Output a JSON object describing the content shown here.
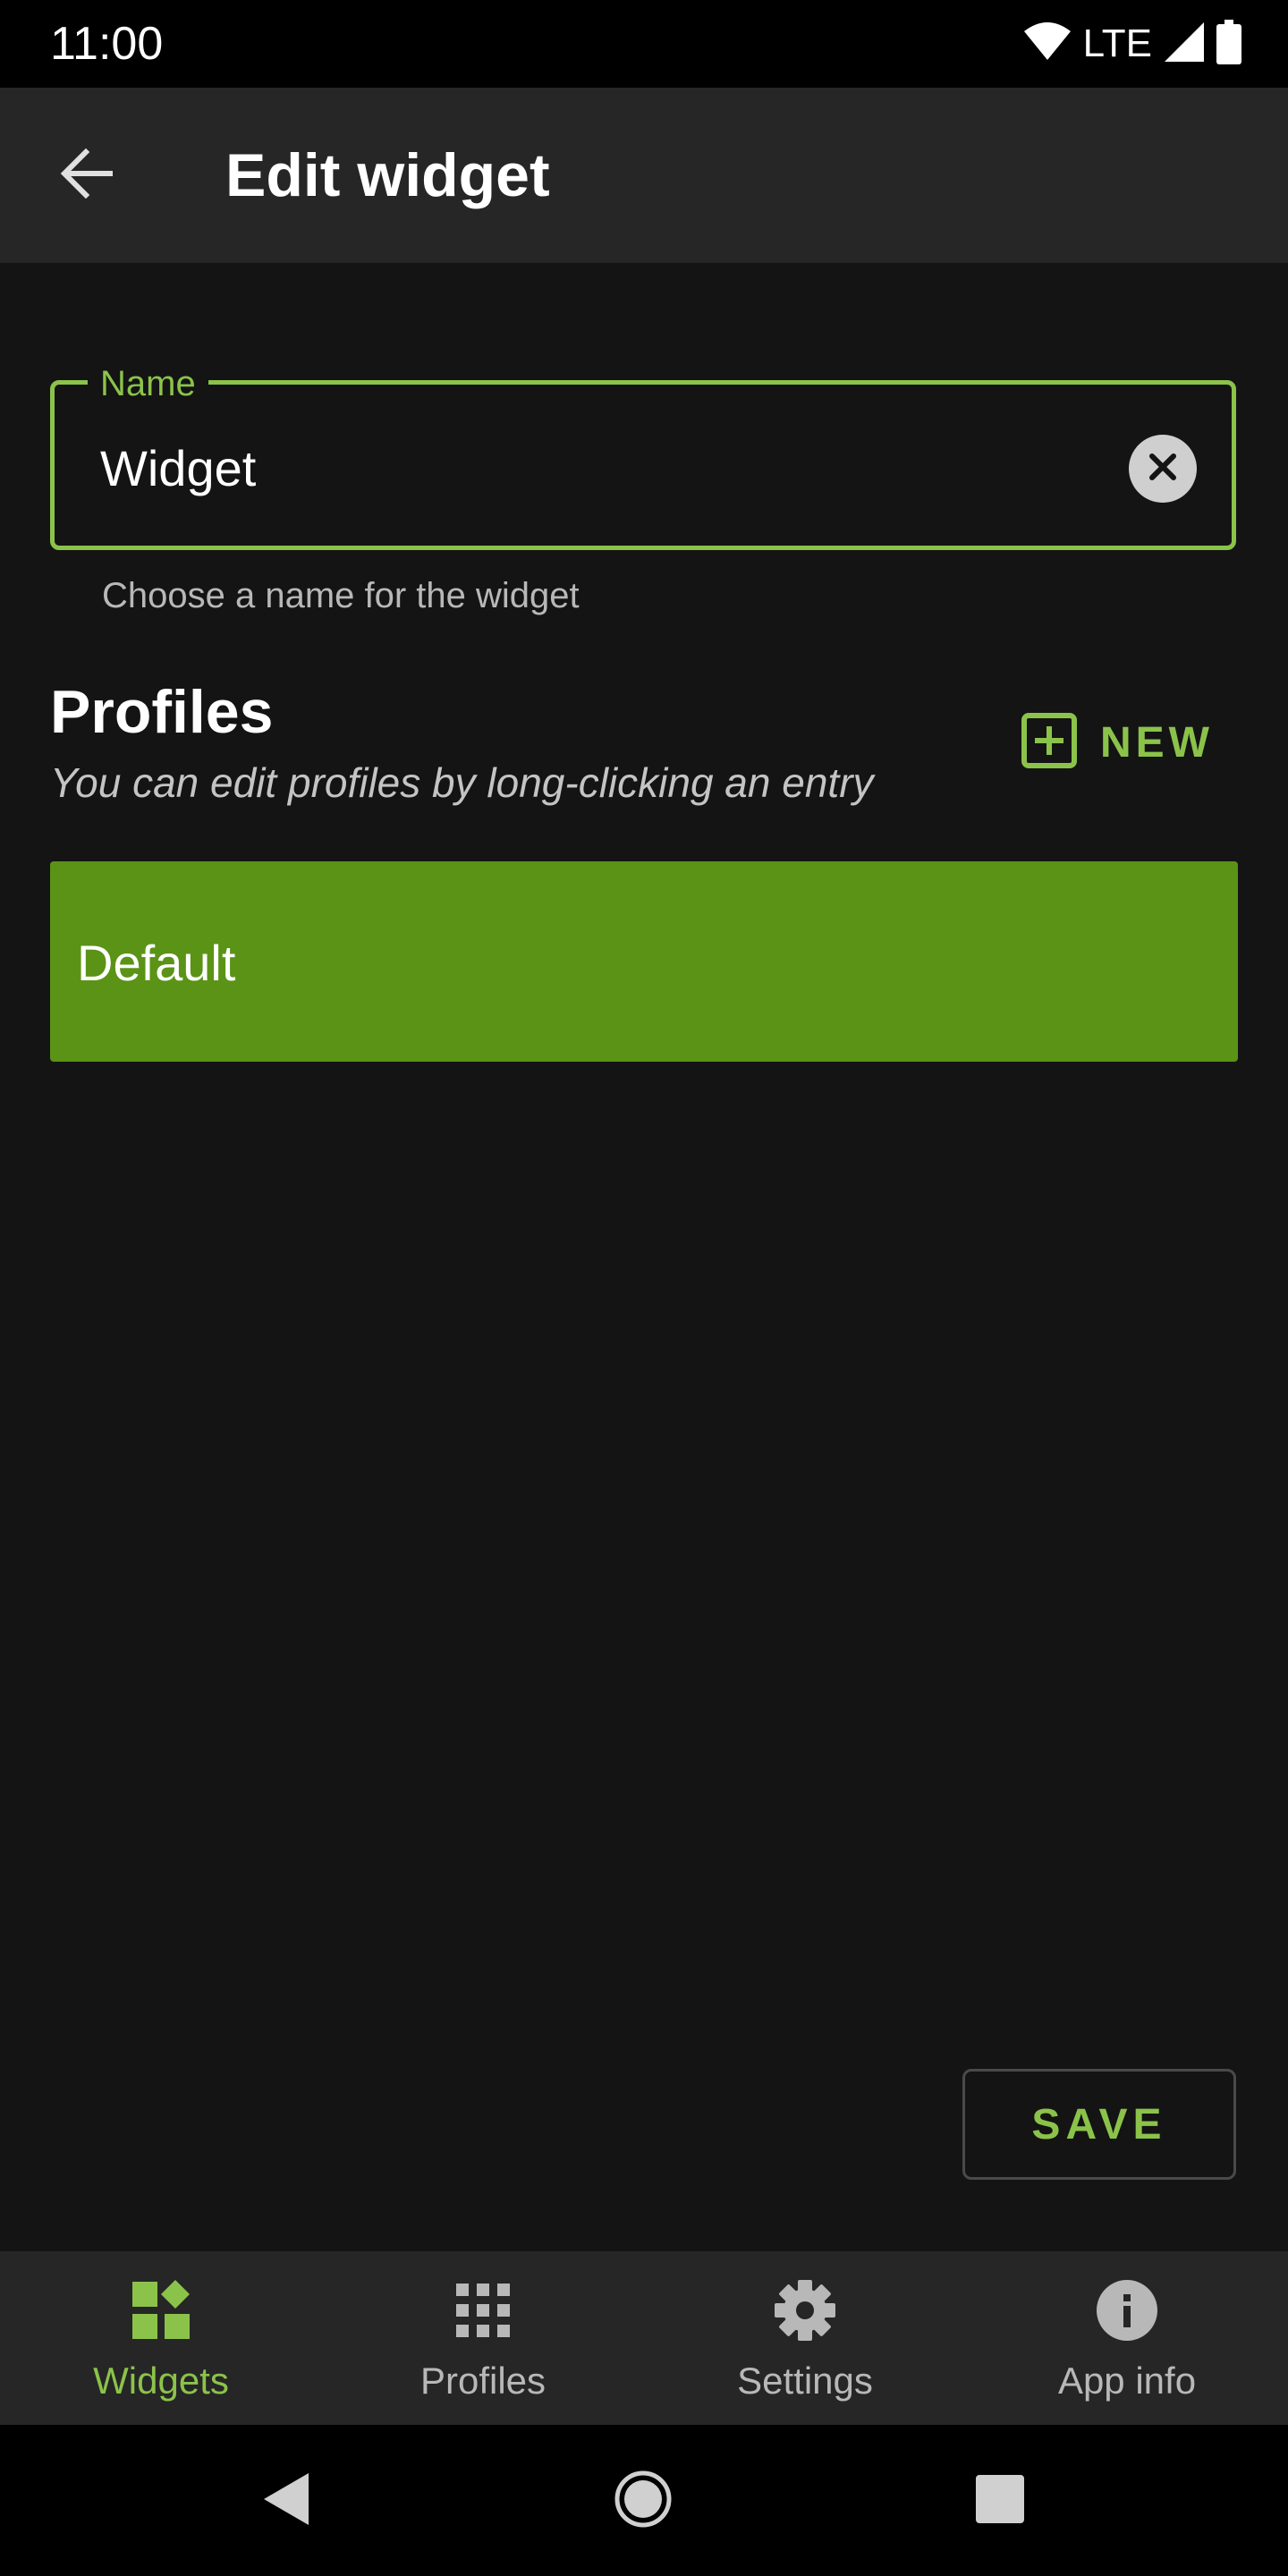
{
  "status_bar": {
    "time": "11:00",
    "network": "LTE"
  },
  "app_bar": {
    "title": "Edit widget"
  },
  "name_field": {
    "label": "Name",
    "value": "Widget",
    "helper": "Choose a name for the widget"
  },
  "profiles": {
    "title": "Profiles",
    "hint": "You can edit profiles by long-clicking an entry",
    "new_label": "NEW",
    "items": [
      {
        "label": "Default"
      }
    ]
  },
  "save_label": "SAVE",
  "bottom_nav": {
    "items": [
      {
        "label": "Widgets",
        "icon": "widgets-icon",
        "active": true
      },
      {
        "label": "Profiles",
        "icon": "grid-icon",
        "active": false
      },
      {
        "label": "Settings",
        "icon": "gear-icon",
        "active": false
      },
      {
        "label": "App info",
        "icon": "info-icon",
        "active": false
      }
    ]
  },
  "colors": {
    "accent": "#8bc34a",
    "selected_item": "#5a9316",
    "background": "#141414",
    "surface": "#262626"
  }
}
